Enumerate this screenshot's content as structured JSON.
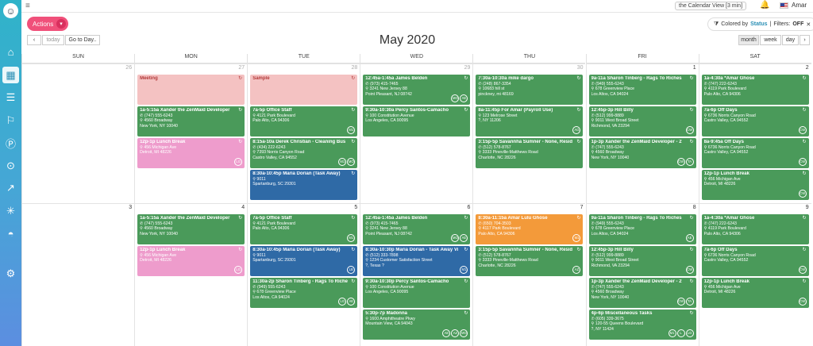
{
  "topbar": {
    "view_chip": "the Calendar View [3 min]",
    "user": "Amar"
  },
  "toolbar": {
    "actions_label": "Actions",
    "colored_by_prefix": "Colored by",
    "colored_by_value": "Status",
    "filters_label": "Filters:",
    "filters_value": "OFF",
    "prev": "‹",
    "next": "›",
    "today": "today",
    "goto": "Go to Day..",
    "month_title": "May 2020",
    "views": [
      "month",
      "week",
      "day"
    ]
  },
  "weekdays": [
    "SUN",
    "MON",
    "TUE",
    "WED",
    "THU",
    "FRI",
    "SAT"
  ],
  "weeks": [
    {
      "days": [
        {
          "num": "26",
          "other": true,
          "events": []
        },
        {
          "num": "27",
          "other": true,
          "events": [
            {
              "color": "salmon",
              "title": "Meeting",
              "lines": [],
              "badges": [],
              "h": 38
            },
            {
              "color": "green",
              "title": "1a-5:15a Xander the ZenMaid Developer",
              "lines": [
                "✆ (747) 555-6243",
                "⚲ 4560 Broadway",
                "New York, NY 10040"
              ],
              "badges": [],
              "h": 38
            },
            {
              "color": "pink",
              "title": "12p-1p Lunch Break",
              "lines": [
                "⚲ 456 Michigan Ave",
                "Detroit, MI 48226"
              ],
              "badges": [
                "LG"
              ],
              "h": 38
            }
          ]
        },
        {
          "num": "28",
          "other": true,
          "events": [
            {
              "color": "salmon",
              "title": "Sample",
              "lines": [],
              "badges": [],
              "h": 38
            },
            {
              "color": "green",
              "title": "7a-5p Office Staff",
              "lines": [
                "⚲ 4121 Park Boulevard",
                "Palo Alto, CA 94306"
              ],
              "badges": [
                "M1"
              ],
              "h": 38
            },
            {
              "color": "green",
              "title": "8:15a-10a Derek Christian - Cleaning Bus",
              "lines": [
                "✆ (434) 222-6243",
                "⚲ 7393 Norris Canyon Road",
                "Castro Valley, CA 94552"
              ],
              "badges": [
                "M1",
                "MO"
              ],
              "h": 38
            },
            {
              "color": "blue",
              "title": "8:30a-10:45p Maria Dorian (Task Away)",
              "lines": [
                "⚲ 9011",
                "Spartanburg, SC 29301"
              ],
              "badges": [],
              "h": 38
            }
          ]
        },
        {
          "num": "29",
          "other": true,
          "events": [
            {
              "color": "green",
              "title": "12:45a-1:45a James Belden",
              "lines": [
                "✆ (973) 415-7465",
                "⚲ 3241 New Jersey 88",
                "Point Pleasant, NJ 08742"
              ],
              "badges": [
                "MO",
                "AE"
              ],
              "h": 38
            },
            {
              "color": "green",
              "title": "9:30a-10:30a Percy Santos-Camacho",
              "lines": [
                "⚲ 100 Constitution Avenue",
                "Los Angeles, CA 90095"
              ],
              "badges": [],
              "h": 38
            }
          ]
        },
        {
          "num": "30",
          "other": true,
          "events": [
            {
              "color": "green",
              "title": "7:30a-10:30a mike dargo",
              "lines": [
                "✆ (248) 867-3354",
                "⚲ 10683 hill st",
                "pinckney, mi 48169"
              ],
              "badges": [],
              "h": 38
            },
            {
              "color": "green",
              "title": "8a-11:45p For Amar (Payroll Use)",
              "lines": [
                "⚲ 123 Melrose Street",
                "?, NY 11206"
              ],
              "badges": [
                "AG"
              ],
              "h": 38
            },
            {
              "color": "green",
              "title": "3:15p-5p Savannha Sumner - None, Resid",
              "lines": [
                "✆ (512) 578-8767",
                "⚲ 3333 Pineville-Matthews Road",
                "Charlotte, NC 28226"
              ],
              "badges": [],
              "h": 38
            }
          ]
        },
        {
          "num": "1",
          "other": false,
          "events": [
            {
              "color": "green",
              "title": "9a-11a Sharon Tinberg - Rags To Riches",
              "lines": [
                "✆ (949) 555-6243",
                "⚲ 678 Greenview Place",
                "Los Altos, CA 94024"
              ],
              "badges": [],
              "h": 38
            },
            {
              "color": "green",
              "title": "12:45p-3p Hill Billy",
              "lines": [
                "✆ (512) 999-8889",
                "⚲ 9011 West Broad Street",
                "Richmond, VA 23294"
              ],
              "badges": [
                "CW"
              ],
              "h": 38
            },
            {
              "color": "green",
              "title": "1p-3p Xander the ZenMaid Developer - 2",
              "lines": [
                "✆ (747) 555-6243",
                "⚲ 4560 Broadway",
                "New York, NY 10040"
              ],
              "badges": [
                "CW",
                "TA"
              ],
              "h": 38
            }
          ]
        },
        {
          "num": "2",
          "other": false,
          "events": [
            {
              "color": "green",
              "title": "1a-4:30a *Amar Ghose",
              "lines": [
                "✆ (747) 222-6243",
                "⚲ 4119 Park Boulevard",
                "Palo Alto, CA 94306"
              ],
              "badges": [],
              "h": 38
            },
            {
              "color": "green",
              "title": "7a-6p Off Days",
              "lines": [
                "⚲ 6736 Norris Canyon Road",
                "Castro Valley, CA 94552"
              ],
              "badges": [
                "CW"
              ],
              "h": 38
            },
            {
              "color": "green",
              "title": "8a-9:45a Off Days",
              "lines": [
                "⚲ 6736 Norris Canyon Road",
                "Castro Valley, CA 94552"
              ],
              "badges": [
                "CW"
              ],
              "h": 38
            },
            {
              "color": "green",
              "title": "12p-1p Lunch Break",
              "lines": [
                "⚲ 456 Michigan Ave",
                "Detroit, MI 48226"
              ],
              "badges": [
                "CW"
              ],
              "h": 38
            }
          ]
        }
      ]
    },
    {
      "days": [
        {
          "num": "3",
          "other": false,
          "events": []
        },
        {
          "num": "4",
          "other": false,
          "events": [
            {
              "color": "green",
              "title": "1a-5:15a Xander the ZenMaid Developer",
              "lines": [
                "✆ (747) 555-6243",
                "⚲ 4560 Broadway",
                "New York, NY 10040"
              ],
              "badges": [],
              "h": 38
            },
            {
              "color": "pink",
              "title": "12p-1p Lunch Break",
              "lines": [
                "⚲ 456 Michigan Ave",
                "Detroit, MI 48226"
              ],
              "badges": [
                "LG"
              ],
              "h": 38
            }
          ]
        },
        {
          "num": "5",
          "other": false,
          "events": [
            {
              "color": "green",
              "title": "7a-5p Office Staff",
              "lines": [
                "⚲ 4121 Park Boulevard",
                "Palo Alto, CA 94306"
              ],
              "badges": [
                "M1"
              ],
              "h": 38
            },
            {
              "color": "blue",
              "title": "8:30a-10:45p Maria Dorian (Task Away)",
              "lines": [
                "⚲ 9011",
                "Spartanburg, SC 29301"
              ],
              "badges": [
                "LB"
              ],
              "h": 38
            },
            {
              "color": "green",
              "title": "11:30a-2p Sharon Tinberg - Rags To Riche",
              "lines": [
                "✆ (949) 555-6243",
                "⚲ 678 Greenview Place",
                "Los Altos, CA 94024"
              ],
              "badges": [
                "LG",
                "AE"
              ],
              "h": 38
            }
          ]
        },
        {
          "num": "6",
          "other": false,
          "events": [
            {
              "color": "green",
              "title": "12:45a-1:45a James Belden",
              "lines": [
                "✆ (973) 415-7465",
                "⚲ 3241 New Jersey 88",
                "Point Pleasant, NJ 08742"
              ],
              "badges": [
                "MO",
                "AE"
              ],
              "h": 38
            },
            {
              "color": "blue",
              "title": "8:30a-10:30p Maria Dorian - Task Away Vi",
              "lines": [
                "✆ (512) 333-7898",
                "⚲ 1234 Customer Satisfaction Street",
                "?, Texas ?"
              ],
              "badges": [
                "M1"
              ],
              "h": 38
            },
            {
              "color": "green",
              "title": "9:30a-10:30p Percy Santos-Camacho",
              "lines": [
                "⚲ 100 Constitution Avenue",
                "Los Angeles, CA 90095"
              ],
              "badges": [],
              "h": 38
            },
            {
              "color": "green",
              "title": "5:30p-7p Madonna",
              "lines": [
                "⚲ 1600 Amphitheatre Pkwy",
                "Mountain View, CA 94043"
              ],
              "badges": [
                "AE",
                "AZ",
                "MO"
              ],
              "h": 38
            }
          ]
        },
        {
          "num": "7",
          "other": false,
          "events": [
            {
              "color": "orange",
              "title": "8:30a-11:15a Amar Lulu Ghose",
              "lines": [
                "✆ (650) 704-3503",
                "⚲ 4117 Park Boulevard",
                "Palo Alto, CA 94306"
              ],
              "badges": [
                "M1"
              ],
              "h": 38
            },
            {
              "color": "green",
              "title": "3:15p-5p Savannha Sumner - None, Resid",
              "lines": [
                "✆ (512) 578-8767",
                "⚲ 3333 Pineville-Matthews Road",
                "Charlotte, NC 28226"
              ],
              "badges": [
                "AZ"
              ],
              "h": 38
            }
          ]
        },
        {
          "num": "8",
          "other": false,
          "events": [
            {
              "color": "green",
              "title": "9a-11a Sharon Tinberg - Rags To Riches",
              "lines": [
                "✆ (949) 555-6243",
                "⚲ 678 Greenview Place",
                "Los Altos, CA 94024"
              ],
              "badges": [
                "AE"
              ],
              "h": 38
            },
            {
              "color": "green",
              "title": "12:45p-3p Hill Billy",
              "lines": [
                "✆ (512) 999-8889",
                "⚲ 9011 West Broad Street",
                "Richmond, VA 23294"
              ],
              "badges": [
                "CW"
              ],
              "h": 38
            },
            {
              "color": "green",
              "title": "1p-3p Xander the ZenMaid Developer - 2",
              "lines": [
                "✆ (747) 555-6243",
                "⚲ 4560 Broadway",
                "New York, NY 10040"
              ],
              "badges": [
                "CW",
                "TA"
              ],
              "h": 38
            },
            {
              "color": "green",
              "title": "4p-6p Miscellaneous Tasks",
              "lines": [
                "✆ (605) 339-3675",
                "⚲ 120-55 Queens Boulevard",
                "?, NY 11424"
              ],
              "badges": [
                "M1",
                "L",
                "LG"
              ],
              "h": 38
            }
          ]
        },
        {
          "num": "9",
          "other": false,
          "events": [
            {
              "color": "green",
              "title": "1a-4:30a *Amar Ghose",
              "lines": [
                "✆ (747) 222-6243",
                "⚲ 4119 Park Boulevard",
                "Palo Alto, CA 94306"
              ],
              "badges": [],
              "h": 38
            },
            {
              "color": "green",
              "title": "7a-6p Off Days",
              "lines": [
                "⚲ 6736 Norris Canyon Road",
                "Castro Valley, CA 94552"
              ],
              "badges": [
                "CW"
              ],
              "h": 38
            },
            {
              "color": "green",
              "title": "12p-1p Lunch Break",
              "lines": [
                "⚲ 456 Michigan Ave",
                "Detroit, MI 48226"
              ],
              "badges": [
                "CW"
              ],
              "h": 38
            }
          ]
        }
      ]
    }
  ]
}
